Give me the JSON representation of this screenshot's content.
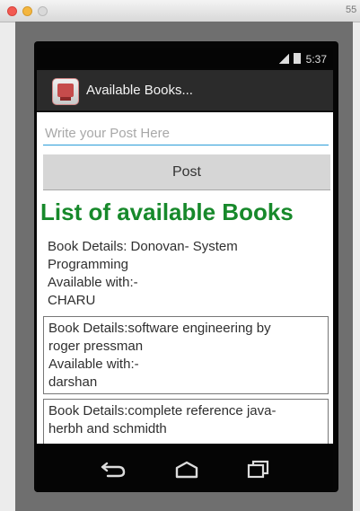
{
  "window": {
    "title": "55"
  },
  "statusbar": {
    "time": "5:37"
  },
  "actionbar": {
    "title": "Available Books..."
  },
  "post": {
    "placeholder": "Write your Post Here",
    "value": "",
    "button_label": "Post"
  },
  "main": {
    "heading": "List of available Books",
    "books": [
      {
        "line1": "Book Details:  Donovan- System",
        "line2": "Programming",
        "line3": "Available with:-",
        "line4": "CHARU"
      },
      {
        "line1": "Book Details:software engineering by",
        "line2": "roger pressman",
        "line3": "Available with:-",
        "line4": "darshan"
      },
      {
        "line1": "Book Details:complete reference java-",
        "line2": "herbh and schmidth"
      }
    ]
  },
  "icons": {
    "app": "book-app-icon",
    "signal": "signal-icon",
    "battery": "battery-icon",
    "back": "back-icon",
    "home": "home-icon",
    "recents": "recent-apps-icon"
  },
  "colors": {
    "heading": "#17892b",
    "input_underline": "#2b9cd8",
    "actionbar": "#2b2b2b",
    "button": "#d6d6d6"
  }
}
